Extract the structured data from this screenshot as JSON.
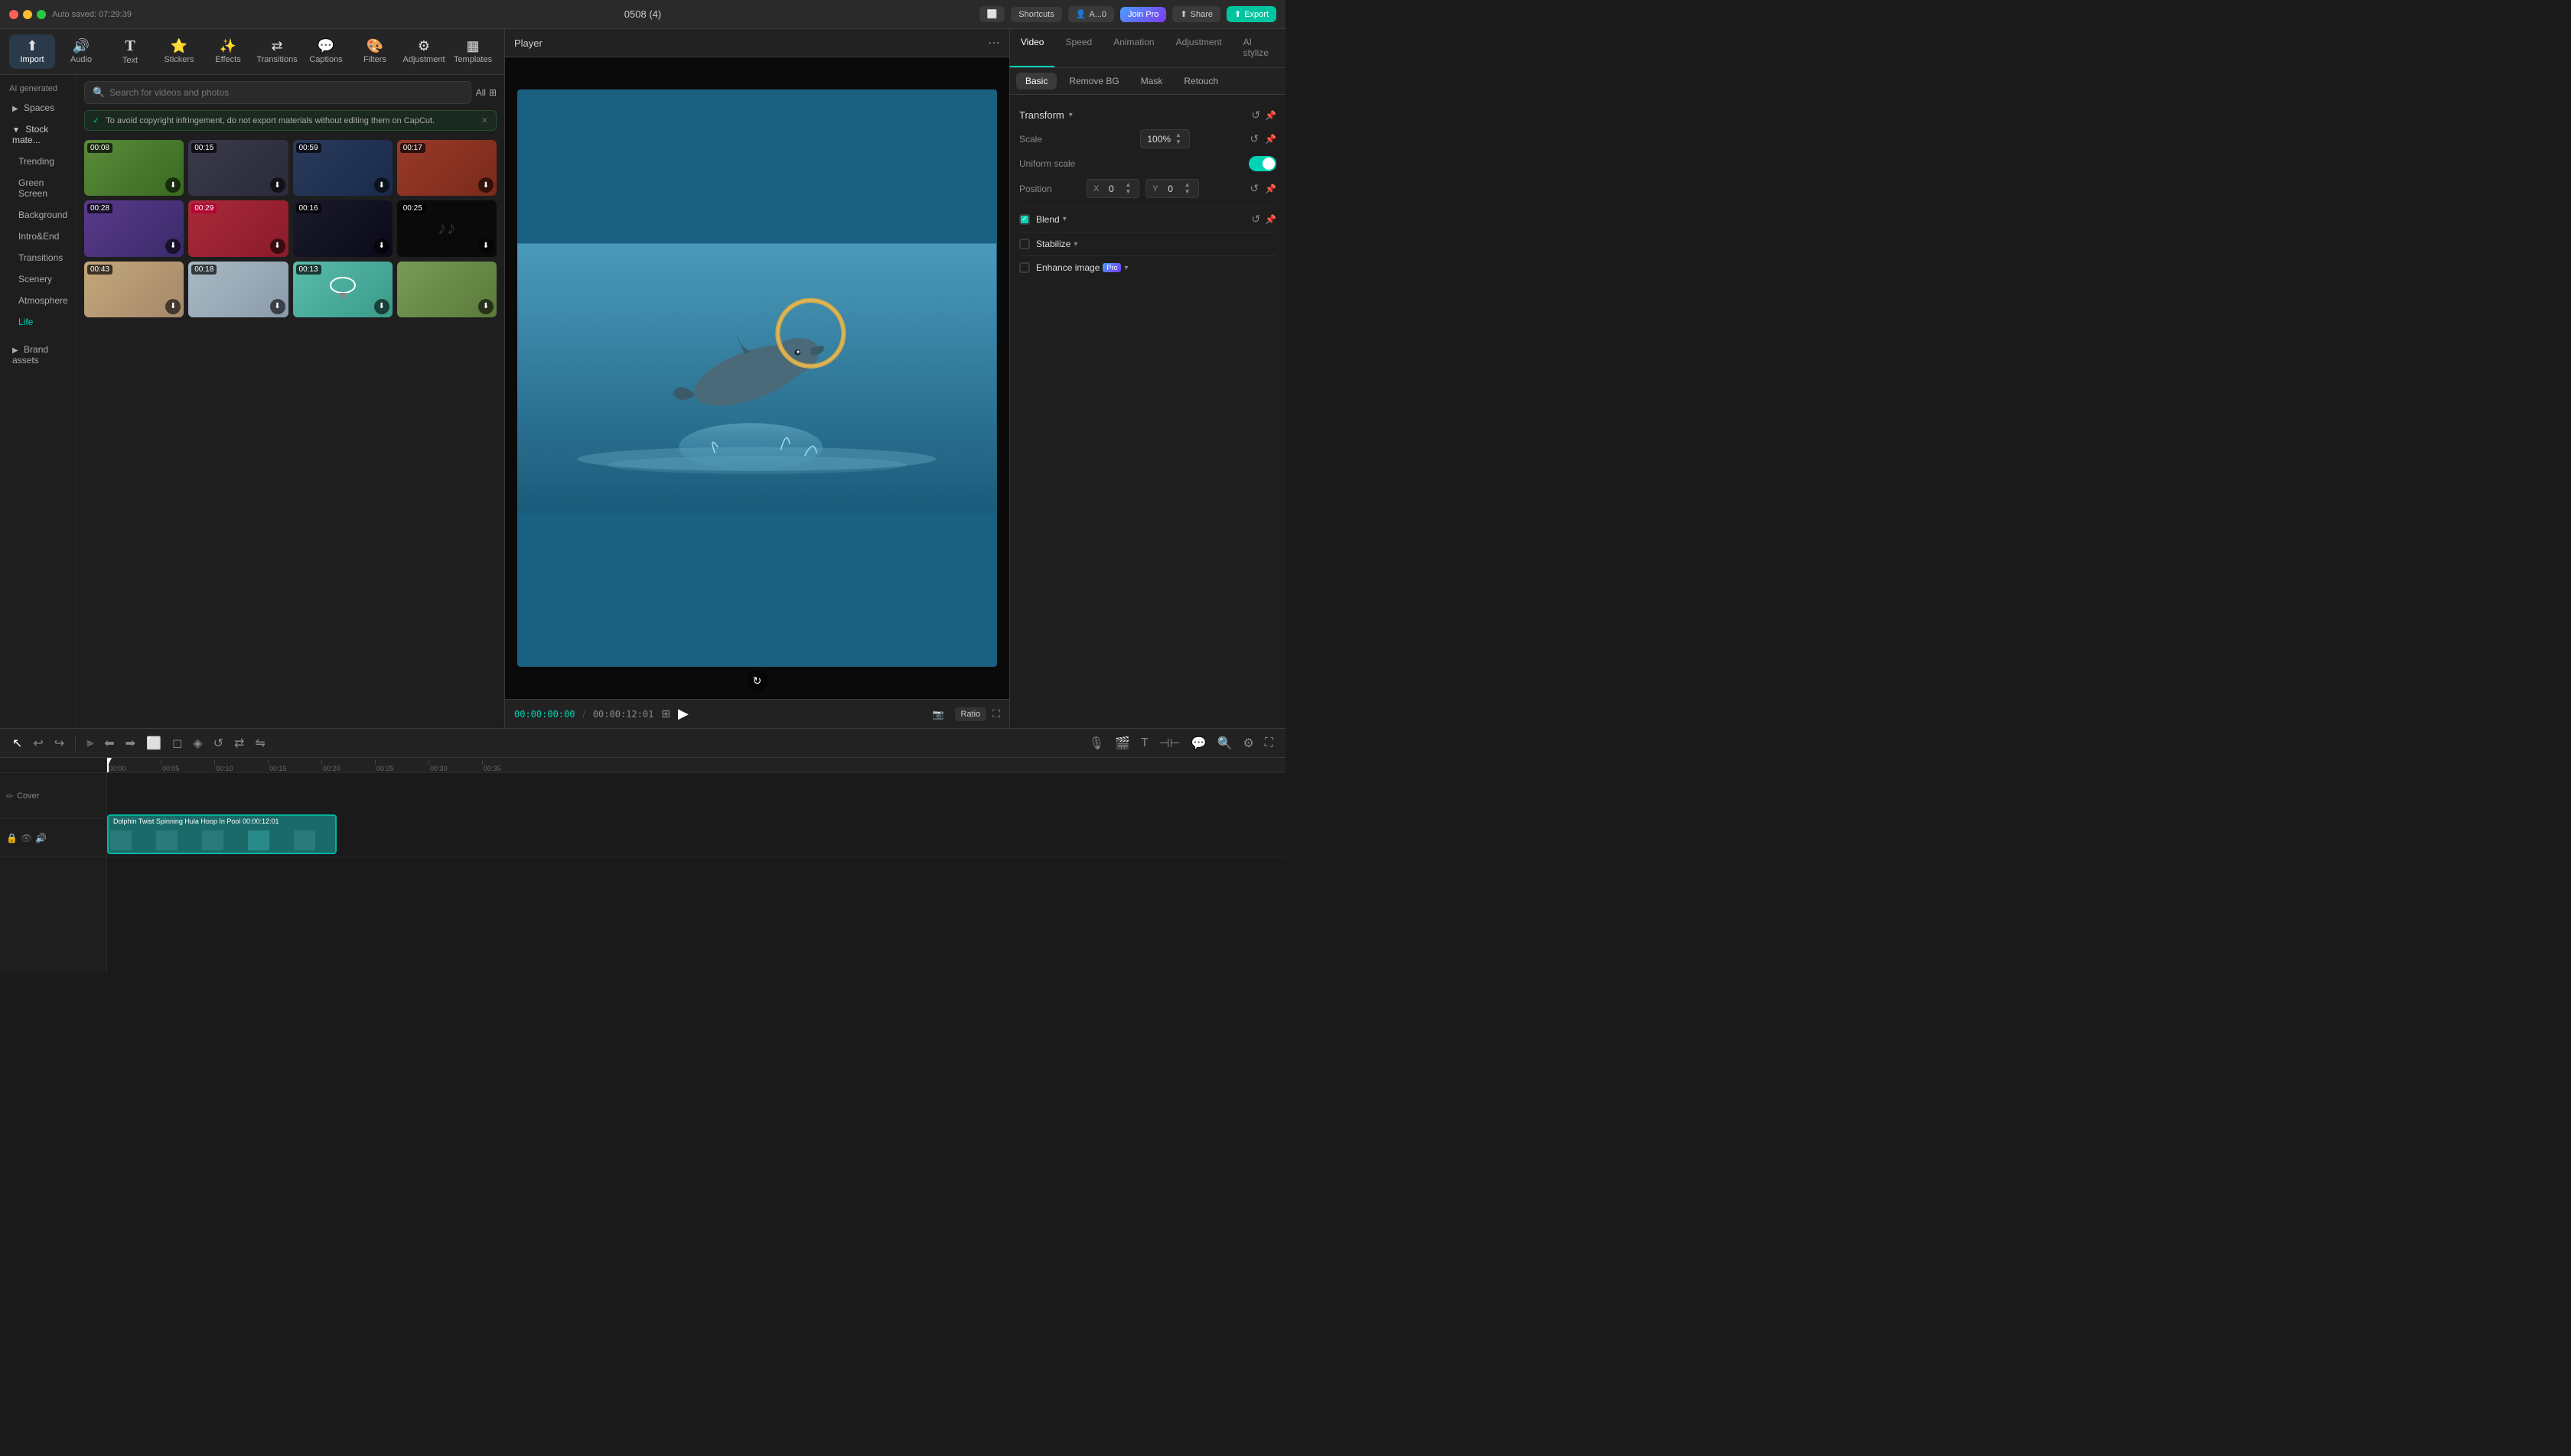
{
  "titleBar": {
    "appTitle": "0508 (4)",
    "autosave": "Auto saved: 07:29:39",
    "shortcuts": "Shortcuts",
    "share": "Share",
    "joinPro": "Join Pro",
    "export": "Export",
    "userInitials": "A...0"
  },
  "toolbar": {
    "items": [
      {
        "id": "import",
        "label": "Import",
        "icon": "⬆"
      },
      {
        "id": "audio",
        "label": "Audio",
        "icon": "🔊"
      },
      {
        "id": "text",
        "label": "Text",
        "icon": "T"
      },
      {
        "id": "stickers",
        "label": "Stickers",
        "icon": "😊"
      },
      {
        "id": "effects",
        "label": "Effects",
        "icon": "✨"
      },
      {
        "id": "transitions",
        "label": "Transitions",
        "icon": "⟷"
      },
      {
        "id": "captions",
        "label": "Captions",
        "icon": "💬"
      },
      {
        "id": "filters",
        "label": "Filters",
        "icon": "🎨"
      },
      {
        "id": "adjustment",
        "label": "Adjustment",
        "icon": "⚙"
      },
      {
        "id": "templates",
        "label": "Templates",
        "icon": "⬜"
      }
    ]
  },
  "sidebar": {
    "items": [
      {
        "id": "spaces",
        "label": "Spaces",
        "hasArrow": true,
        "active": false
      },
      {
        "id": "stock-mate",
        "label": "Stock mate...",
        "hasArrow": true,
        "active": true
      },
      {
        "id": "trending",
        "label": "Trending",
        "active": false
      },
      {
        "id": "green-screen",
        "label": "Green Screen",
        "active": false
      },
      {
        "id": "background",
        "label": "Background",
        "active": false
      },
      {
        "id": "intro-end",
        "label": "Intro&End",
        "active": false
      },
      {
        "id": "transitions",
        "label": "Transitions",
        "active": false
      },
      {
        "id": "scenery",
        "label": "Scenery",
        "active": false
      },
      {
        "id": "atmosphere",
        "label": "Atmosphere",
        "active": false
      },
      {
        "id": "life",
        "label": "Life",
        "active": true,
        "highlighted": true
      },
      {
        "id": "brand-assets",
        "label": "Brand assets",
        "hasArrow": true,
        "active": false
      }
    ],
    "aiGeneratedLabel": "AI generated"
  },
  "search": {
    "placeholder": "Search for videos and photos",
    "allLabel": "All"
  },
  "notice": {
    "text": "To avoid copyright infringement, do not export materials without editing them on CapCut.",
    "checkIcon": "✓"
  },
  "videos": [
    {
      "id": "v1",
      "duration": "00:08",
      "colorClass": "vt-1",
      "durationRed": false
    },
    {
      "id": "v2",
      "duration": "00:15",
      "colorClass": "vt-2",
      "durationRed": false
    },
    {
      "id": "v3",
      "duration": "00:59",
      "colorClass": "vt-3",
      "durationRed": false
    },
    {
      "id": "v4",
      "duration": "00:17",
      "colorClass": "vt-4",
      "durationRed": false
    },
    {
      "id": "v5",
      "duration": "00:28",
      "colorClass": "vt-5",
      "durationRed": false
    },
    {
      "id": "v6",
      "duration": "00:29",
      "colorClass": "vt-6",
      "durationRed": true
    },
    {
      "id": "v7",
      "duration": "00:16",
      "colorClass": "vt-7",
      "durationRed": false
    },
    {
      "id": "v8",
      "duration": "00:25",
      "colorClass": "vt-8",
      "durationRed": false
    },
    {
      "id": "v9",
      "duration": "00:43",
      "colorClass": "vt-9",
      "durationRed": false
    },
    {
      "id": "v10",
      "duration": "00:18",
      "colorClass": "vt-10",
      "durationRed": false
    },
    {
      "id": "v11",
      "duration": "00:13",
      "colorClass": "vt-11",
      "durationRed": false
    },
    {
      "id": "v12",
      "duration": "",
      "colorClass": "vt-12",
      "durationRed": false
    }
  ],
  "player": {
    "title": "Player",
    "currentTime": "00:00:00:00",
    "totalTime": "00:00:12:01",
    "ratioLabel": "Ratio"
  },
  "rightPanel": {
    "tabs": [
      "Video",
      "Speed",
      "Animation",
      "Adjustment",
      "AI stylize"
    ],
    "activeTab": "Video",
    "subTabs": [
      "Basic",
      "Remove BG",
      "Mask",
      "Retouch"
    ],
    "activeSubTab": "Basic"
  },
  "properties": {
    "transformLabel": "Transform",
    "scaleLabel": "Scale",
    "scaleValue": "100%",
    "uniformScaleLabel": "Uniform scale",
    "positionLabel": "Position",
    "posX": "0",
    "posY": "0",
    "blendLabel": "Blend",
    "stabilizeLabel": "Stabilize",
    "enhanceImageLabel": "Enhance image"
  },
  "timeline": {
    "clipLabel": "Dolphin Twist Spinning Hula Hoop In Pool",
    "clipDuration": "00:00:12:01",
    "coverLabel": "Cover",
    "timeMarks": [
      "00:00",
      "00:05",
      "00:10",
      "00:15",
      "00:20",
      "00:25",
      "00:30",
      "00:35"
    ]
  }
}
